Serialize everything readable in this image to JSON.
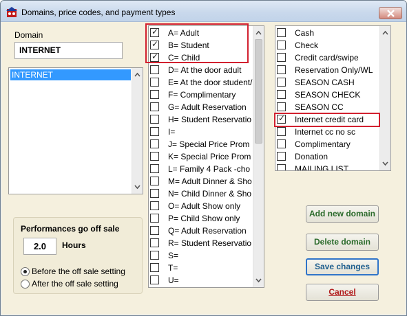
{
  "window": {
    "title": "Domains, price codes, and payment types"
  },
  "domain": {
    "label": "Domain",
    "value": "INTERNET",
    "list_items": [
      "INTERNET"
    ]
  },
  "offsale": {
    "title": "Performances go off sale",
    "hours_value": "2.0",
    "hours_label": "Hours",
    "radio_before": "Before the off sale setting",
    "radio_after": "After the off sale setting",
    "selected": "before"
  },
  "price_codes": [
    {
      "label": "A= Adult",
      "checked": true
    },
    {
      "label": "B= Student",
      "checked": true
    },
    {
      "label": "C= Child",
      "checked": true
    },
    {
      "label": "D= At the door adult",
      "checked": false
    },
    {
      "label": "E= At the door student/",
      "checked": false
    },
    {
      "label": "F= Complimentary",
      "checked": false
    },
    {
      "label": "G= Adult Reservation",
      "checked": false
    },
    {
      "label": "H= Student Reservatio",
      "checked": false
    },
    {
      "label": "I=",
      "checked": false
    },
    {
      "label": "J= Special Price Prom",
      "checked": false
    },
    {
      "label": "K= Special Price Prom",
      "checked": false
    },
    {
      "label": "L= Family 4 Pack -cho",
      "checked": false
    },
    {
      "label": "M= Adult Dinner & Sho",
      "checked": false
    },
    {
      "label": "N= Child Dinner & Sho",
      "checked": false
    },
    {
      "label": "O= Adult Show only",
      "checked": false
    },
    {
      "label": "P= Child Show only",
      "checked": false
    },
    {
      "label": "Q= Adult Reservation",
      "checked": false
    },
    {
      "label": "R= Student Reservatio",
      "checked": false
    },
    {
      "label": "S=",
      "checked": false
    },
    {
      "label": "T=",
      "checked": false
    },
    {
      "label": "U=",
      "checked": false
    }
  ],
  "payment_types": [
    {
      "label": "Cash",
      "checked": false
    },
    {
      "label": "Check",
      "checked": false
    },
    {
      "label": "Credit card/swipe",
      "checked": false
    },
    {
      "label": "Reservation Only/WL",
      "checked": false
    },
    {
      "label": "SEASON CASH",
      "checked": false
    },
    {
      "label": "SEASON CHECK",
      "checked": false
    },
    {
      "label": "SEASON CC",
      "checked": false
    },
    {
      "label": "Internet credit card",
      "checked": true
    },
    {
      "label": "Internet cc no sc",
      "checked": false
    },
    {
      "label": "Complimentary",
      "checked": false
    },
    {
      "label": "Donation",
      "checked": false
    },
    {
      "label": "MAILING LIST",
      "checked": false
    }
  ],
  "buttons": {
    "add": "Add new domain",
    "delete": "Delete domain",
    "save": "Save changes",
    "cancel": "Cancel"
  },
  "colors": {
    "highlight": "#d2202f",
    "selection": "#3399ff",
    "dialog_bg": "#f5f0de"
  }
}
